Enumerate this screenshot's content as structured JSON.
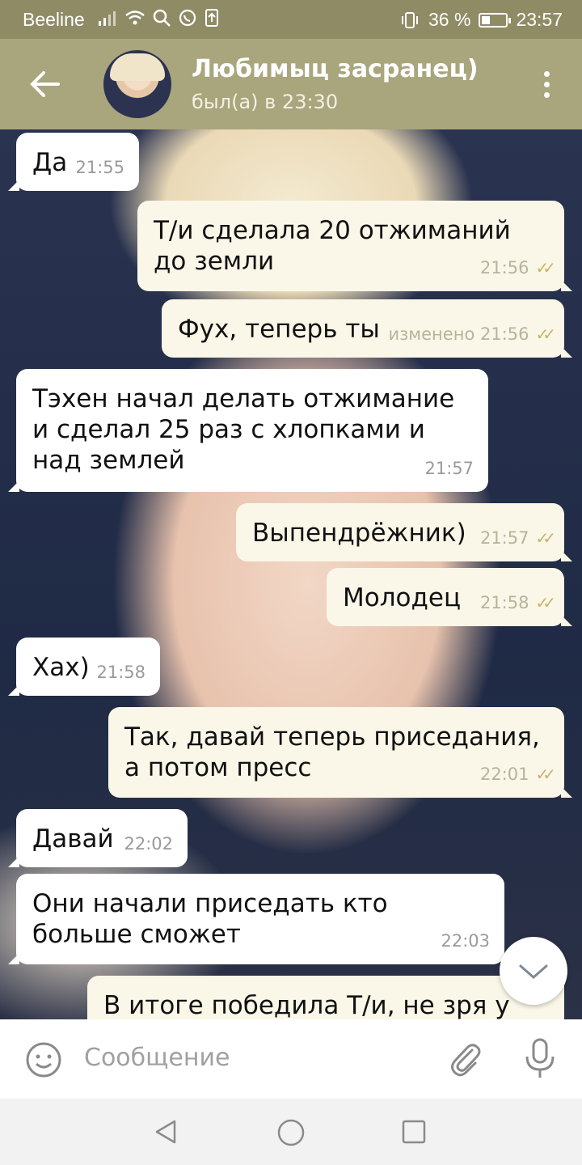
{
  "status_bar": {
    "carrier": "Beeline",
    "battery": "36 %",
    "battery_level": 0.36,
    "time": "23:57"
  },
  "header": {
    "title": "Любимыц засранец)",
    "subtitle": "был(а) в 23:30"
  },
  "messages": [
    {
      "text": "Да",
      "time": "21:55",
      "direction": "in"
    },
    {
      "text": "Т/и сделала 20 отжиманий до земли",
      "time": "21:56",
      "direction": "out",
      "read": true
    },
    {
      "text": "Фух, теперь ты",
      "time": "изменено 21:56",
      "direction": "out",
      "read": true
    },
    {
      "text": "Тэхен начал делать отжимание и сделал 25 раз с хлопками и над землей",
      "time": "21:57",
      "direction": "in"
    },
    {
      "text": "Выпендрёжник)",
      "time": "21:57",
      "direction": "out",
      "read": true
    },
    {
      "text": "Молодец",
      "time": "21:58",
      "direction": "out",
      "read": true
    },
    {
      "text": "Хах)",
      "time": "21:58",
      "direction": "in"
    },
    {
      "text": "Так, давай теперь приседания, а потом пресс",
      "time": "22:01",
      "direction": "out",
      "read": true
    },
    {
      "text": "Давай",
      "time": "22:02",
      "direction": "in"
    },
    {
      "text": "Они начали приседать кто больше сможет",
      "time": "22:03",
      "direction": "in"
    },
    {
      "text": "В итоге победила Т/и, не зря у нее",
      "time": "",
      "direction": "out"
    }
  ],
  "composer": {
    "placeholder": "Сообщение"
  },
  "icons": {
    "back": "arrow-left-icon",
    "menu": "more-vert-icon",
    "emoji": "smile-icon",
    "attach": "paperclip-icon",
    "mic": "microphone-icon",
    "scroll": "chevron-down-icon"
  },
  "colors": {
    "header": "#a9a57d",
    "status_bar": "#8f8b65",
    "incoming_bubble": "#ffffff",
    "outgoing_bubble": "#fbf7e8",
    "read_check": "#c8b36b"
  }
}
